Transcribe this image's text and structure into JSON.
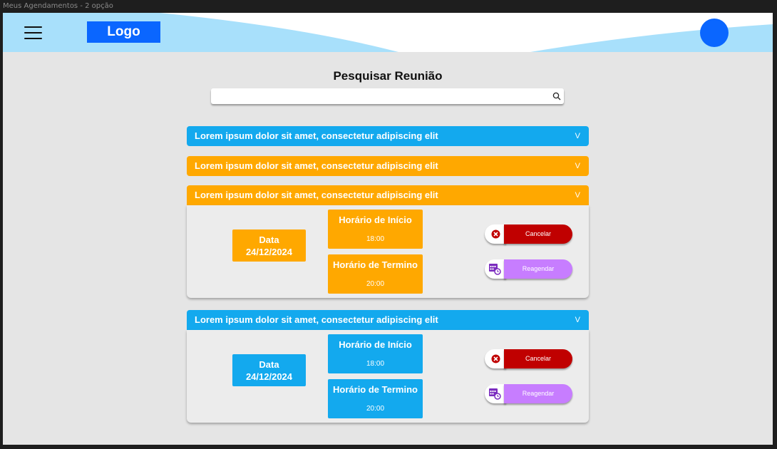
{
  "window": {
    "title": "Meus Agendamentos - 2 opção"
  },
  "header": {
    "logo": "Logo",
    "menu_icon": "hamburger-icon",
    "avatar": "avatar"
  },
  "search": {
    "title": "Pesquisar Reunião",
    "placeholder": "",
    "value": "",
    "icon": "search-icon"
  },
  "accordions": [
    {
      "title": "Lorem ipsum dolor sit amet, consectetur adipiscing elit",
      "chevron": "V",
      "color": "#13a9ee",
      "open": false
    },
    {
      "title": "Lorem ipsum dolor sit amet, consectetur adipiscing elit",
      "chevron": "V",
      "color": "#ffa800",
      "open": false
    },
    {
      "title": "Lorem ipsum dolor sit amet, consectetur adipiscing elit",
      "chevron": "V",
      "color": "#ffa800",
      "open": true,
      "date_label": "Data",
      "date_value": "24/12/2024",
      "start_label": "Horário de Início",
      "start_value": "18:00",
      "end_label": "Horário de Termino",
      "end_value": "20:00",
      "cancel_label": "Cancelar",
      "reschedule_label": "Reagendar"
    },
    {
      "title": "Lorem ipsum dolor sit amet, consectetur adipiscing elit",
      "chevron": "V",
      "color": "#13a9ee",
      "open": true,
      "date_label": "Data",
      "date_value": "24/12/2024",
      "start_label": "Horário de Início",
      "start_value": "18:00",
      "end_label": "Horário de Termino",
      "end_value": "20:00",
      "cancel_label": "Cancelar",
      "reschedule_label": "Reagendar"
    }
  ],
  "colors": {
    "brand_blue": "#0a66ff",
    "header_wave": "#a8e0fb",
    "accent_blue": "#13a9ee",
    "accent_orange": "#ffa800",
    "cancel_red": "#c00000",
    "reschedule_purple": "#c77dff"
  }
}
